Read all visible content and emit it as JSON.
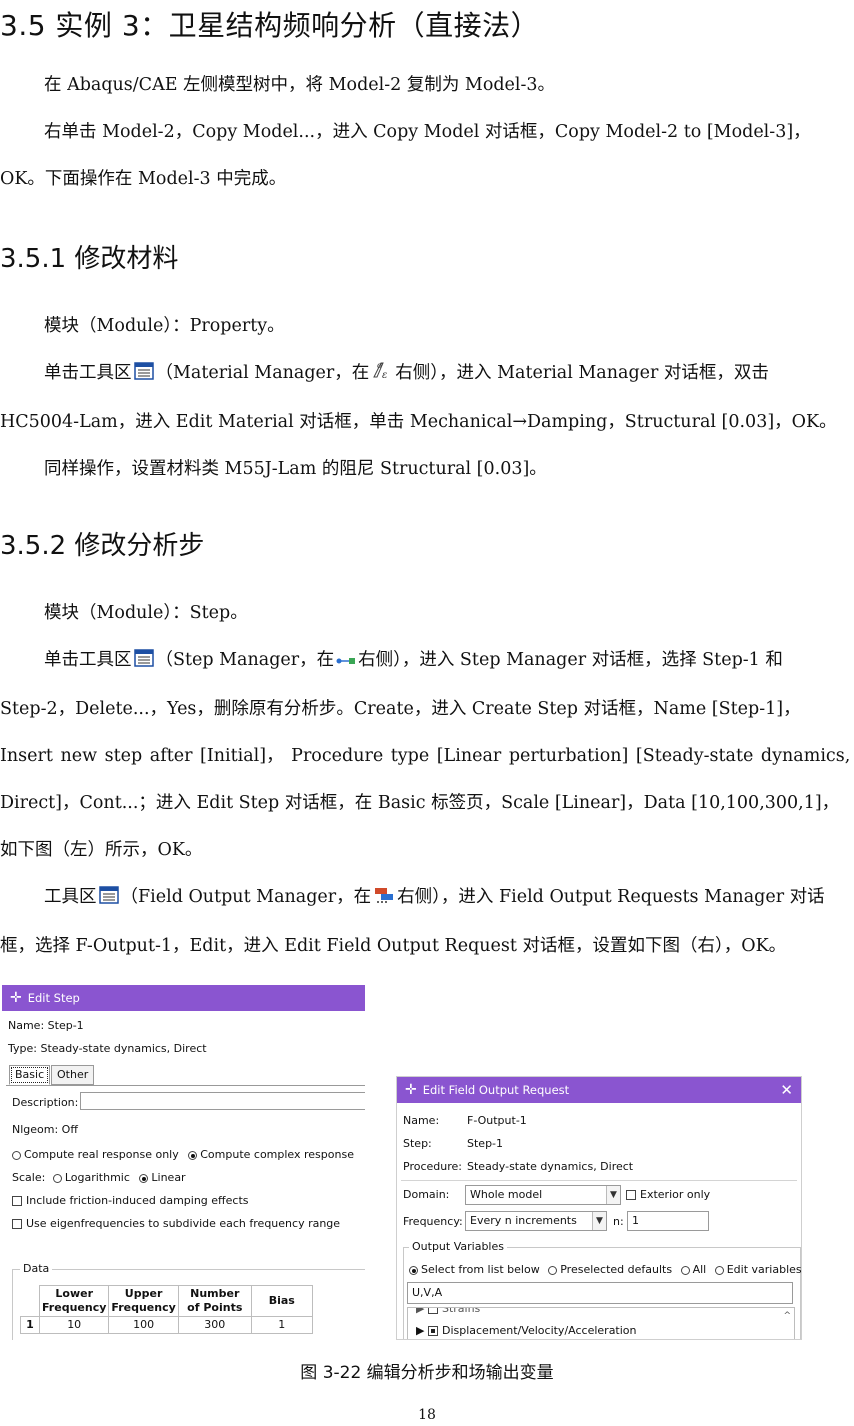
{
  "section": {
    "title": "3.5  实例 3：卫星结构频响分析（直接法）",
    "paras": [
      "在 Abaqus/CAE 左侧模型树中，将 Model-2 复制为 Model-3。",
      "右单击 Model-2，Copy Model...，进入 Copy Model 对话框，Copy Model-2 to [Model-3]，",
      "OK。下面操作在 Model-3 中完成。"
    ]
  },
  "sub1": {
    "title": "3.5.1  修改材料",
    "p1": "模块（Module）：Property。",
    "p2a": "单击工具区",
    "p2b": "（Material Manager，在",
    "p2c": "右侧），进入 Material Manager 对话框，双击",
    "p2d": "HC5004-Lam，进入 Edit Material 对话框，单击 Mechanical→Damping，Structural [0.03]，OK。",
    "p3": "同样操作，设置材料类 M55J-Lam 的阻尼 Structural [0.03]。"
  },
  "sub2": {
    "title": "3.5.2  修改分析步",
    "p1": "模块（Module）：Step。",
    "p2a": "单击工具区",
    "p2b": "（Step Manager，在",
    "p2c": "右侧），进入 Step Manager 对话框，选择 Step-1 和",
    "p2d": "Step-2，Delete...，Yes，删除原有分析步。Create，进入 Create Step 对话框，Name [Step-1]，",
    "p2e": "Insert  new  step  after  [Initial]，  Procedure  type  [Linear  perturbation]  [Steady-state  dynamics,",
    "p2f": "Direct]，Cont...；进入 Edit Step 对话框，在 Basic 标签页，Scale [Linear]，Data [10,100,300,1]，",
    "p2g": "如下图（左）所示，OK。",
    "p3a": "工具区",
    "p3b": "（Field Output Manager，在",
    "p3c": "右侧），进入 Field Output Requests Manager 对话",
    "p3d": "框，选择 F-Output-1，Edit，进入 Edit Field Output Request 对话框，设置如下图（右），OK。"
  },
  "edit_step": {
    "title": "Edit Step",
    "name": "Name:  Step-1",
    "type": "Type:  Steady-state dynamics, Direct",
    "tab_basic": "Basic",
    "tab_other": "Other",
    "description_label": "Description:",
    "nlgeom": "Nlgeom:  Off",
    "opt_real": "Compute real response only",
    "opt_complex": "Compute complex response",
    "scale_label": "Scale:",
    "scale_log": "Logarithmic",
    "scale_lin": "Linear",
    "chk_friction": "Include friction-induced damping effects",
    "chk_eigen": "Use eigenfrequencies to subdivide each frequency range",
    "data_label": "Data",
    "columns": [
      "Lower\nFrequency",
      "Upper\nFrequency",
      "Number\nof Points",
      "Bias"
    ],
    "row_num": "1",
    "row": [
      "10",
      "100",
      "300",
      "1"
    ]
  },
  "edit_field": {
    "title": "Edit Field Output Request",
    "close": "✕",
    "name_label": "Name:",
    "name_value": "F-Output-1",
    "step_label": "Step:",
    "step_value": "Step-1",
    "proc_label": "Procedure:",
    "proc_value": "Steady-state dynamics, Direct",
    "domain_label": "Domain:",
    "domain_value": "Whole model",
    "exterior": "Exterior only",
    "freq_label": "Frequency:",
    "freq_value": "Every n increments",
    "n_label": "n:",
    "n_value": "1",
    "ov_label": "Output Variables",
    "opt_select": "Select from list below",
    "opt_preset": "Preselected defaults",
    "opt_all": "All",
    "opt_edit": "Edit variables",
    "vars": "U,V,A",
    "tree_item0": "Strains",
    "tree_item1": "Displacement/Velocity/Acceleration"
  },
  "caption": "图 3-22   编辑分析步和场输出变量",
  "page_number": "18",
  "colors": {
    "titlebar": "#8a55d0"
  }
}
